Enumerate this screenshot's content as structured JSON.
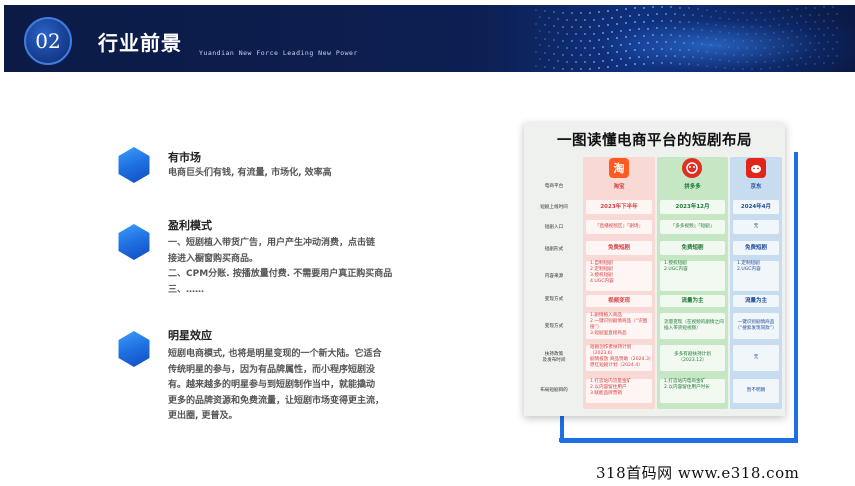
{
  "header": {
    "number": "02",
    "title": "行业前景",
    "subtitle": "Yuandian New Force Leading New Power"
  },
  "sections": [
    {
      "icon": "hexagon-icon",
      "title": "有市场",
      "lines": [
        "电商巨头们有钱, 有流量, 市场化, 效率高"
      ]
    },
    {
      "icon": "hexagon-icon",
      "title": "盈利模式",
      "lines": [
        "一、短剧植入带货广告，用户产生冲动消费，点击链",
        "接进入橱窗购买商品。",
        "二、CPM分账. 按播放量付费. 不需要用户真正购买商品",
        "三、……"
      ]
    },
    {
      "icon": "hexagon-icon",
      "title": "明星效应",
      "lines": [
        "短剧电商模式, 也将是明星变现的一个新大陆。它适合",
        "传统明星的参与，因为有品牌属性，而小程序短剧没",
        "有。越来越多的明星参与到短剧制作当中，就能撬动",
        "更多的品牌资源和免费流量，让短剧市场变得更主流，",
        "更出圈, 更普及。"
      ]
    }
  ],
  "infographic": {
    "title": "一图读懂电商平台的短剧布局",
    "logo_text": "淘",
    "row_labels": [
      "电商平台",
      "短剧上线时间",
      "短剧入口",
      "短剧形式",
      "内容来源",
      "变现方式",
      "变现方式",
      "扶持政策\n及发布时间",
      "布局短剧目的"
    ],
    "platforms": [
      {
        "name": "淘宝",
        "launch": "2023年下半年",
        "entry": "「直播视频区」「剧场」",
        "form": "免费短剧",
        "source": [
          "1.自制短剧",
          "2.定制短剧",
          "3.授权短剧",
          "4.UGC内容"
        ],
        "monetize": "视频变现",
        "method": [
          "1.剧情植入商品",
          "2.一键识别剧情商品（“识图搜”）",
          "3.短剧里直接商品"
        ],
        "policy": [
          "短剧创作者扶持计划（2023.6）",
          "剧情投放 商品赞助（2024.3）",
          "原红短剧计划（2024.4）"
        ],
        "goal": [
          "1.打造站内流量金矿",
          "2.以内容留住用户",
          "3.赋能品牌营销"
        ]
      },
      {
        "name": "拼多多",
        "launch": "2023年12月",
        "entry": "「多多视频」「短剧」",
        "form": "免费短剧",
        "source": [
          "1.授权短剧",
          "2.UGC内容"
        ],
        "monetize": "流量为主",
        "method": [
          "流量变现（在视频的剧情之间插入带货短视频）"
        ],
        "policy": [
          "多多有剧扶持计划",
          "（2023.12）"
        ],
        "goal": [
          "1.打造站内电商金矿",
          "2.以内容留住用户时长"
        ]
      },
      {
        "name": "京东",
        "launch": "2024年4月",
        "entry": "无",
        "form": "免费短剧",
        "source": [
          "1.定制短剧",
          "2.UGC内容"
        ],
        "monetize": "流量为主",
        "method": [
          "一键识别剧情商品",
          "（“搜索发现同款”）"
        ],
        "policy": [
          "无"
        ],
        "goal": [
          "暂不明朗"
        ]
      }
    ],
    "colors": {
      "taobao": "#f9d9d6",
      "pdd": "#c6e7c4",
      "jd": "#c7dcef",
      "frame": "#1e6fe6"
    }
  },
  "watermark": "318首码网  www.e318.com"
}
